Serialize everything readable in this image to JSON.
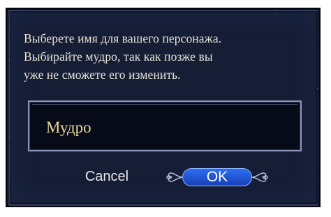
{
  "dialog": {
    "prompt_lines": [
      "Выберете имя для вашего персонажа.",
      "Выбирайте мудро, так как позже вы",
      "уже не сможете его изменить."
    ],
    "name_field": {
      "value": "Мудро"
    },
    "buttons": {
      "cancel_label": "Cancel",
      "ok_label": "OK"
    }
  },
  "colors": {
    "panel_background": "#161e36",
    "text": "#e8e4d6",
    "input_text": "#e6d79a",
    "ok_button": "#1f55d8"
  },
  "icons": {
    "ok_ornament": "scroll-ornament-icon"
  }
}
